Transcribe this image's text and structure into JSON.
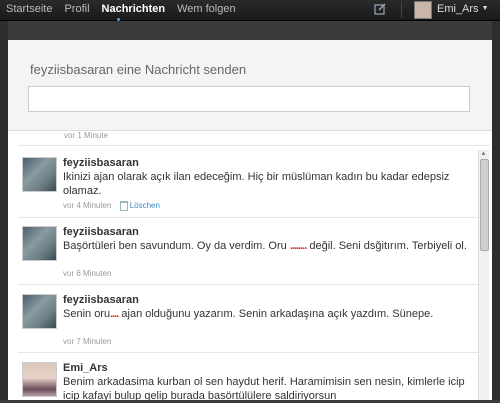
{
  "nav": {
    "items": [
      "Startseite",
      "Profil",
      "Nachrichten",
      "Wem folgen"
    ],
    "active_index": 2
  },
  "header": {
    "username": "Emi_Ars",
    "compose_icon": "compose-icon"
  },
  "compose": {
    "title": "feyziisbasaran eine Nachricht senden",
    "input_value": ""
  },
  "messages": {
    "top_time": "vor 1 Minute",
    "items": [
      {
        "user": "feyziisbasaran",
        "text": "Ikinizi ajan olarak açık ilan edeceğim. Hiç bir müslüman kadın bu kadar edepsiz olamaz.",
        "time": "vor 4 Minuten",
        "delete_label": "Löschen"
      },
      {
        "user": "feyziisbasaran",
        "text_before": "Başörtüleri ben savundum. Oy da verdim. Oru",
        "dots": "........",
        "text_after": "değil. Seni dsğitırım. Terbiyeli ol.",
        "time": "vor 6 Minuten"
      },
      {
        "user": "feyziisbasaran",
        "text_before": "Senin oru",
        "dots": "....",
        "text_after": "ajan olduğunu yazarım. Senin arkadaşına açık yazdım. Sünepe.",
        "time": "vor 7 Minuten"
      },
      {
        "user": "Emi_Ars",
        "text": "Benim arkadasima kurban ol sen haydut herif. Haramimisin sen nesin, kimlerle icip icip kafayi bulup gelip burada basörtülülere saldiriyorsun"
      }
    ]
  },
  "colors": {
    "topbar": "#1f1f1f",
    "link": "#3b8bc2",
    "censor_dots": "#d33333"
  }
}
